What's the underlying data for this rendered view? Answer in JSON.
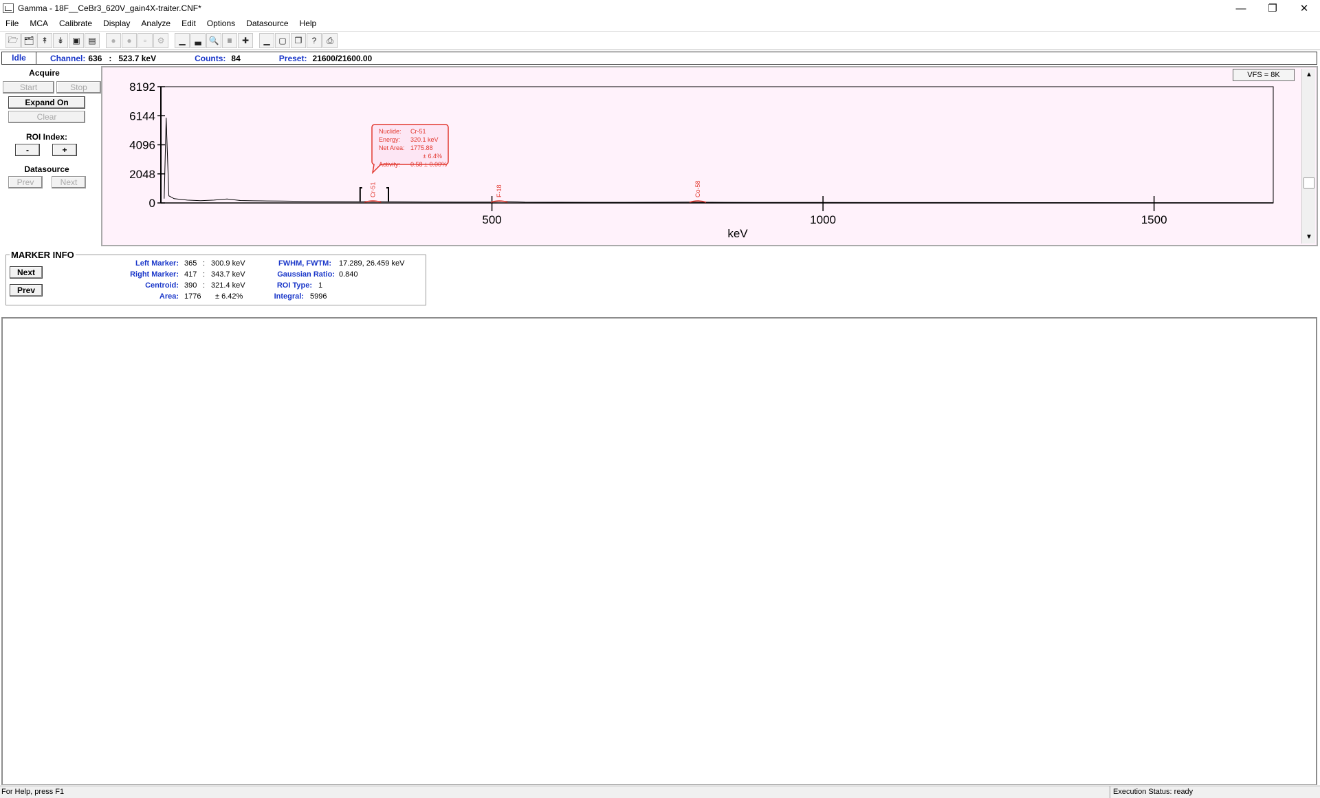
{
  "window": {
    "title": "Gamma - 18F__CeBr3_620V_gain4X-traiter.CNF*"
  },
  "menu": [
    "File",
    "MCA",
    "Calibrate",
    "Display",
    "Analyze",
    "Edit",
    "Options",
    "Datasource",
    "Help"
  ],
  "status_line": {
    "state": "Idle",
    "channel_label": "Channel:",
    "channel_value": "636",
    "energy_value": "523.7 keV",
    "counts_label": "Counts:",
    "counts_value": "84",
    "preset_label": "Preset:",
    "preset_value": "21600/21600.00"
  },
  "left_panel": {
    "acquire_title": "Acquire",
    "start": "Start",
    "stop": "Stop",
    "expand": "Expand On",
    "clear": "Clear",
    "roi_title": "ROI Index:",
    "roi_minus": "-",
    "roi_plus": "+",
    "datasource_title": "Datasource",
    "prev": "Prev",
    "next": "Next"
  },
  "spectrum": {
    "vfs": "VFS = 8K",
    "y_ticks": [
      "8192",
      "6144",
      "4096",
      "2048",
      "0"
    ],
    "x_ticks": [
      "500",
      "1000",
      "1500"
    ],
    "x_label": "keV",
    "peak_labels": [
      "Cr-51",
      "F-18",
      "Co-58"
    ],
    "tooltip": {
      "nuclide_label": "Nuclide:",
      "nuclide_value": "Cr-51",
      "energy_label": "Energy:",
      "energy_value": "320.1 keV",
      "netarea_label": "Net Area:",
      "netarea_value": "1775.88",
      "netarea_unc": "± 6.4%",
      "activity_label": "Activity:",
      "activity_value": "0.58 ± 0.00%"
    }
  },
  "chart_data": {
    "type": "line",
    "x_axis_unit": "keV",
    "xlabel": "keV",
    "ylim": [
      0,
      8192
    ],
    "y_ticks": [
      0,
      2048,
      4096,
      6144,
      8192
    ],
    "x_ticks": [
      500,
      1000,
      1500
    ],
    "series": [
      {
        "x": [
          5,
          8,
          12,
          20,
          40,
          60,
          80,
          100,
          120,
          140,
          160,
          180,
          200,
          220,
          240,
          260,
          280,
          300,
          320,
          340,
          360,
          380,
          400,
          450,
          500,
          511,
          550,
          600,
          650,
          700,
          750,
          800,
          850,
          900,
          1000,
          1100,
          1200,
          1300,
          1400,
          1500,
          1600,
          1680
        ],
        "y": [
          300,
          6000,
          500,
          300,
          200,
          160,
          200,
          280,
          170,
          150,
          140,
          130,
          120,
          110,
          100,
          100,
          95,
          90,
          110,
          90,
          80,
          75,
          70,
          65,
          60,
          120,
          55,
          50,
          45,
          45,
          50,
          60,
          45,
          40,
          35,
          30,
          30,
          25,
          25,
          20,
          20,
          15
        ]
      }
    ],
    "markers_keV": [
      300.9,
      343.7
    ],
    "peaks": [
      {
        "label": "Cr-51",
        "energy_keV": 320.1
      },
      {
        "label": "F-18",
        "energy_keV": 511
      },
      {
        "label": "Co-58",
        "energy_keV": 811
      }
    ]
  },
  "marker_info": {
    "title": "MARKER INFO",
    "next": "Next",
    "prev": "Prev",
    "left_marker_label": "Left Marker:",
    "left_marker_ch": "365",
    "left_marker_e": "300.9 keV",
    "right_marker_label": "Right Marker:",
    "right_marker_ch": "417",
    "right_marker_e": "343.7 keV",
    "centroid_label": "Centroid:",
    "centroid_ch": "390",
    "centroid_e": "321.4 keV",
    "area_label": "Area:",
    "area_val": "1776",
    "area_unc": "± 6.42%",
    "sep": ":",
    "fwhm_label": "FWHM, FWTM:",
    "fwhm_val": "17.289, 26.459 keV",
    "gauss_label": "Gaussian Ratio:",
    "gauss_val": "0.840",
    "roitype_label": "ROI Type:",
    "roitype_val": "1",
    "integral_label": "Integral:",
    "integral_val": "5996"
  },
  "statusbar": {
    "help": "For Help, press F1",
    "exec": "Execution Status: ready"
  },
  "colors": {
    "label_blue": "#1a37c9",
    "plot_bg": "#fff2fb",
    "peak_red": "#e2382f"
  }
}
